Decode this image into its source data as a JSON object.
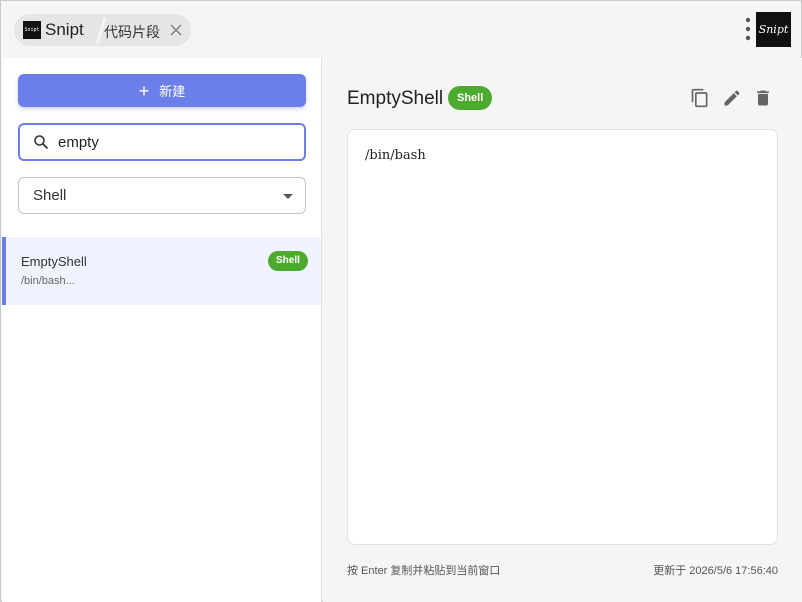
{
  "titlebar": {
    "app_name": "Snipt",
    "app_logo_text": "Snipt",
    "tab_label": "代码片段",
    "brand_logo_text": "Snipt"
  },
  "sidebar": {
    "new_button_label": "新建",
    "search": {
      "value": "empty"
    },
    "language_select": {
      "selected": "Shell"
    },
    "items": [
      {
        "title": "EmptyShell",
        "preview": "/bin/bash...",
        "badge": "Shell"
      }
    ]
  },
  "main": {
    "title": "EmptyShell",
    "badge": "Shell",
    "code": "/bin/bash",
    "hint": "按 Enter 复制并粘贴到当前窗口",
    "updated": "更新于 2026/5/6 17:56:40"
  },
  "colors": {
    "accent": "#6c7ee8",
    "badge_green": "#4caa2e",
    "selected_item_bg": "#f0f3fd"
  },
  "icons": [
    "close-icon",
    "more-vert-icon",
    "plus-icon",
    "search-icon",
    "caret-down-icon",
    "copy-icon",
    "edit-icon",
    "delete-icon"
  ]
}
